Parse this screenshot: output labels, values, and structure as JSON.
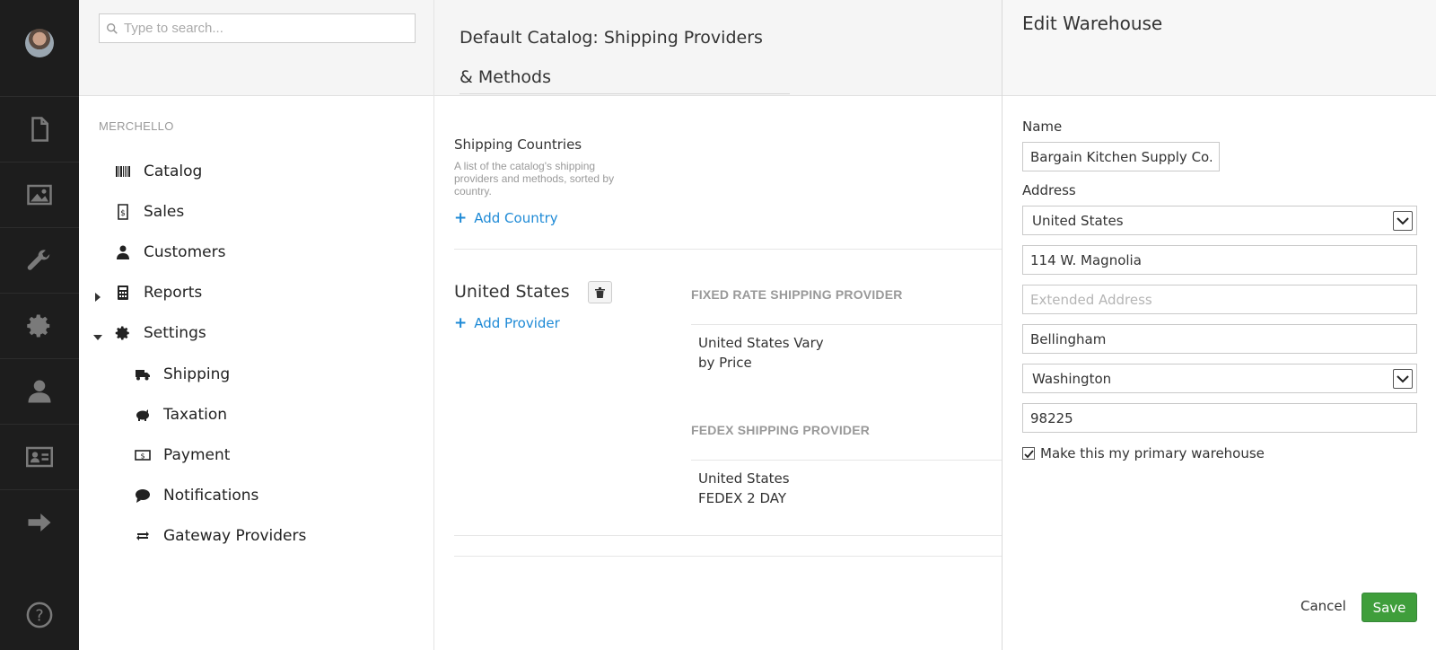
{
  "sidebar": {
    "avatar": "user-avatar",
    "icons": [
      "content-icon",
      "media-icon",
      "developer-wrench-icon",
      "settings-gear-icon",
      "users-icon",
      "members-card-icon",
      "forms-arrow-icon"
    ],
    "help_icon": "help-icon"
  },
  "tree": {
    "search_placeholder": "Type to search...",
    "section_title": "MERCHELLO",
    "items": [
      {
        "label": "Catalog",
        "icon": "barcode-icon"
      },
      {
        "label": "Sales",
        "icon": "receipt-icon"
      },
      {
        "label": "Customers",
        "icon": "person-icon"
      },
      {
        "label": "Reports",
        "icon": "calculator-icon"
      },
      {
        "label": "Settings",
        "icon": "gear-icon"
      }
    ],
    "settings_children": [
      {
        "label": "Shipping",
        "icon": "truck-icon"
      },
      {
        "label": "Taxation",
        "icon": "piggybank-icon"
      },
      {
        "label": "Payment",
        "icon": "money-icon"
      },
      {
        "label": "Notifications",
        "icon": "chat-bubble-icon"
      },
      {
        "label": "Gateway Providers",
        "icon": "exchange-icon"
      }
    ]
  },
  "main": {
    "title": "Default Catalog: Shipping Providers & Methods",
    "countries_title": "Shipping Countries",
    "countries_desc": "A list of the catalog's shipping providers and methods, sorted by country.",
    "add_country": "Add Country",
    "country": "United States",
    "add_provider": "Add Provider",
    "providers": [
      {
        "title": "FIXED RATE SHIPPING PROVIDER",
        "method": [
          "United States Vary",
          "by Price"
        ]
      },
      {
        "title": "FEDEX SHIPPING PROVIDER",
        "method": [
          "United States",
          "FEDEX 2 DAY"
        ]
      }
    ]
  },
  "edit": {
    "title": "Edit Warehouse",
    "name_label": "Name",
    "name_value": "Bargain Kitchen Supply Co.",
    "address_label": "Address",
    "country_value": "United States",
    "address1": "114 W. Magnolia",
    "address2_placeholder": "Extended Address",
    "city": "Bellingham",
    "region_value": "Washington",
    "postal": "98225",
    "primary_label": "Make this my primary warehouse",
    "primary_checked": true,
    "cancel": "Cancel",
    "save": "Save",
    "save_color": "#3f9e3b"
  }
}
